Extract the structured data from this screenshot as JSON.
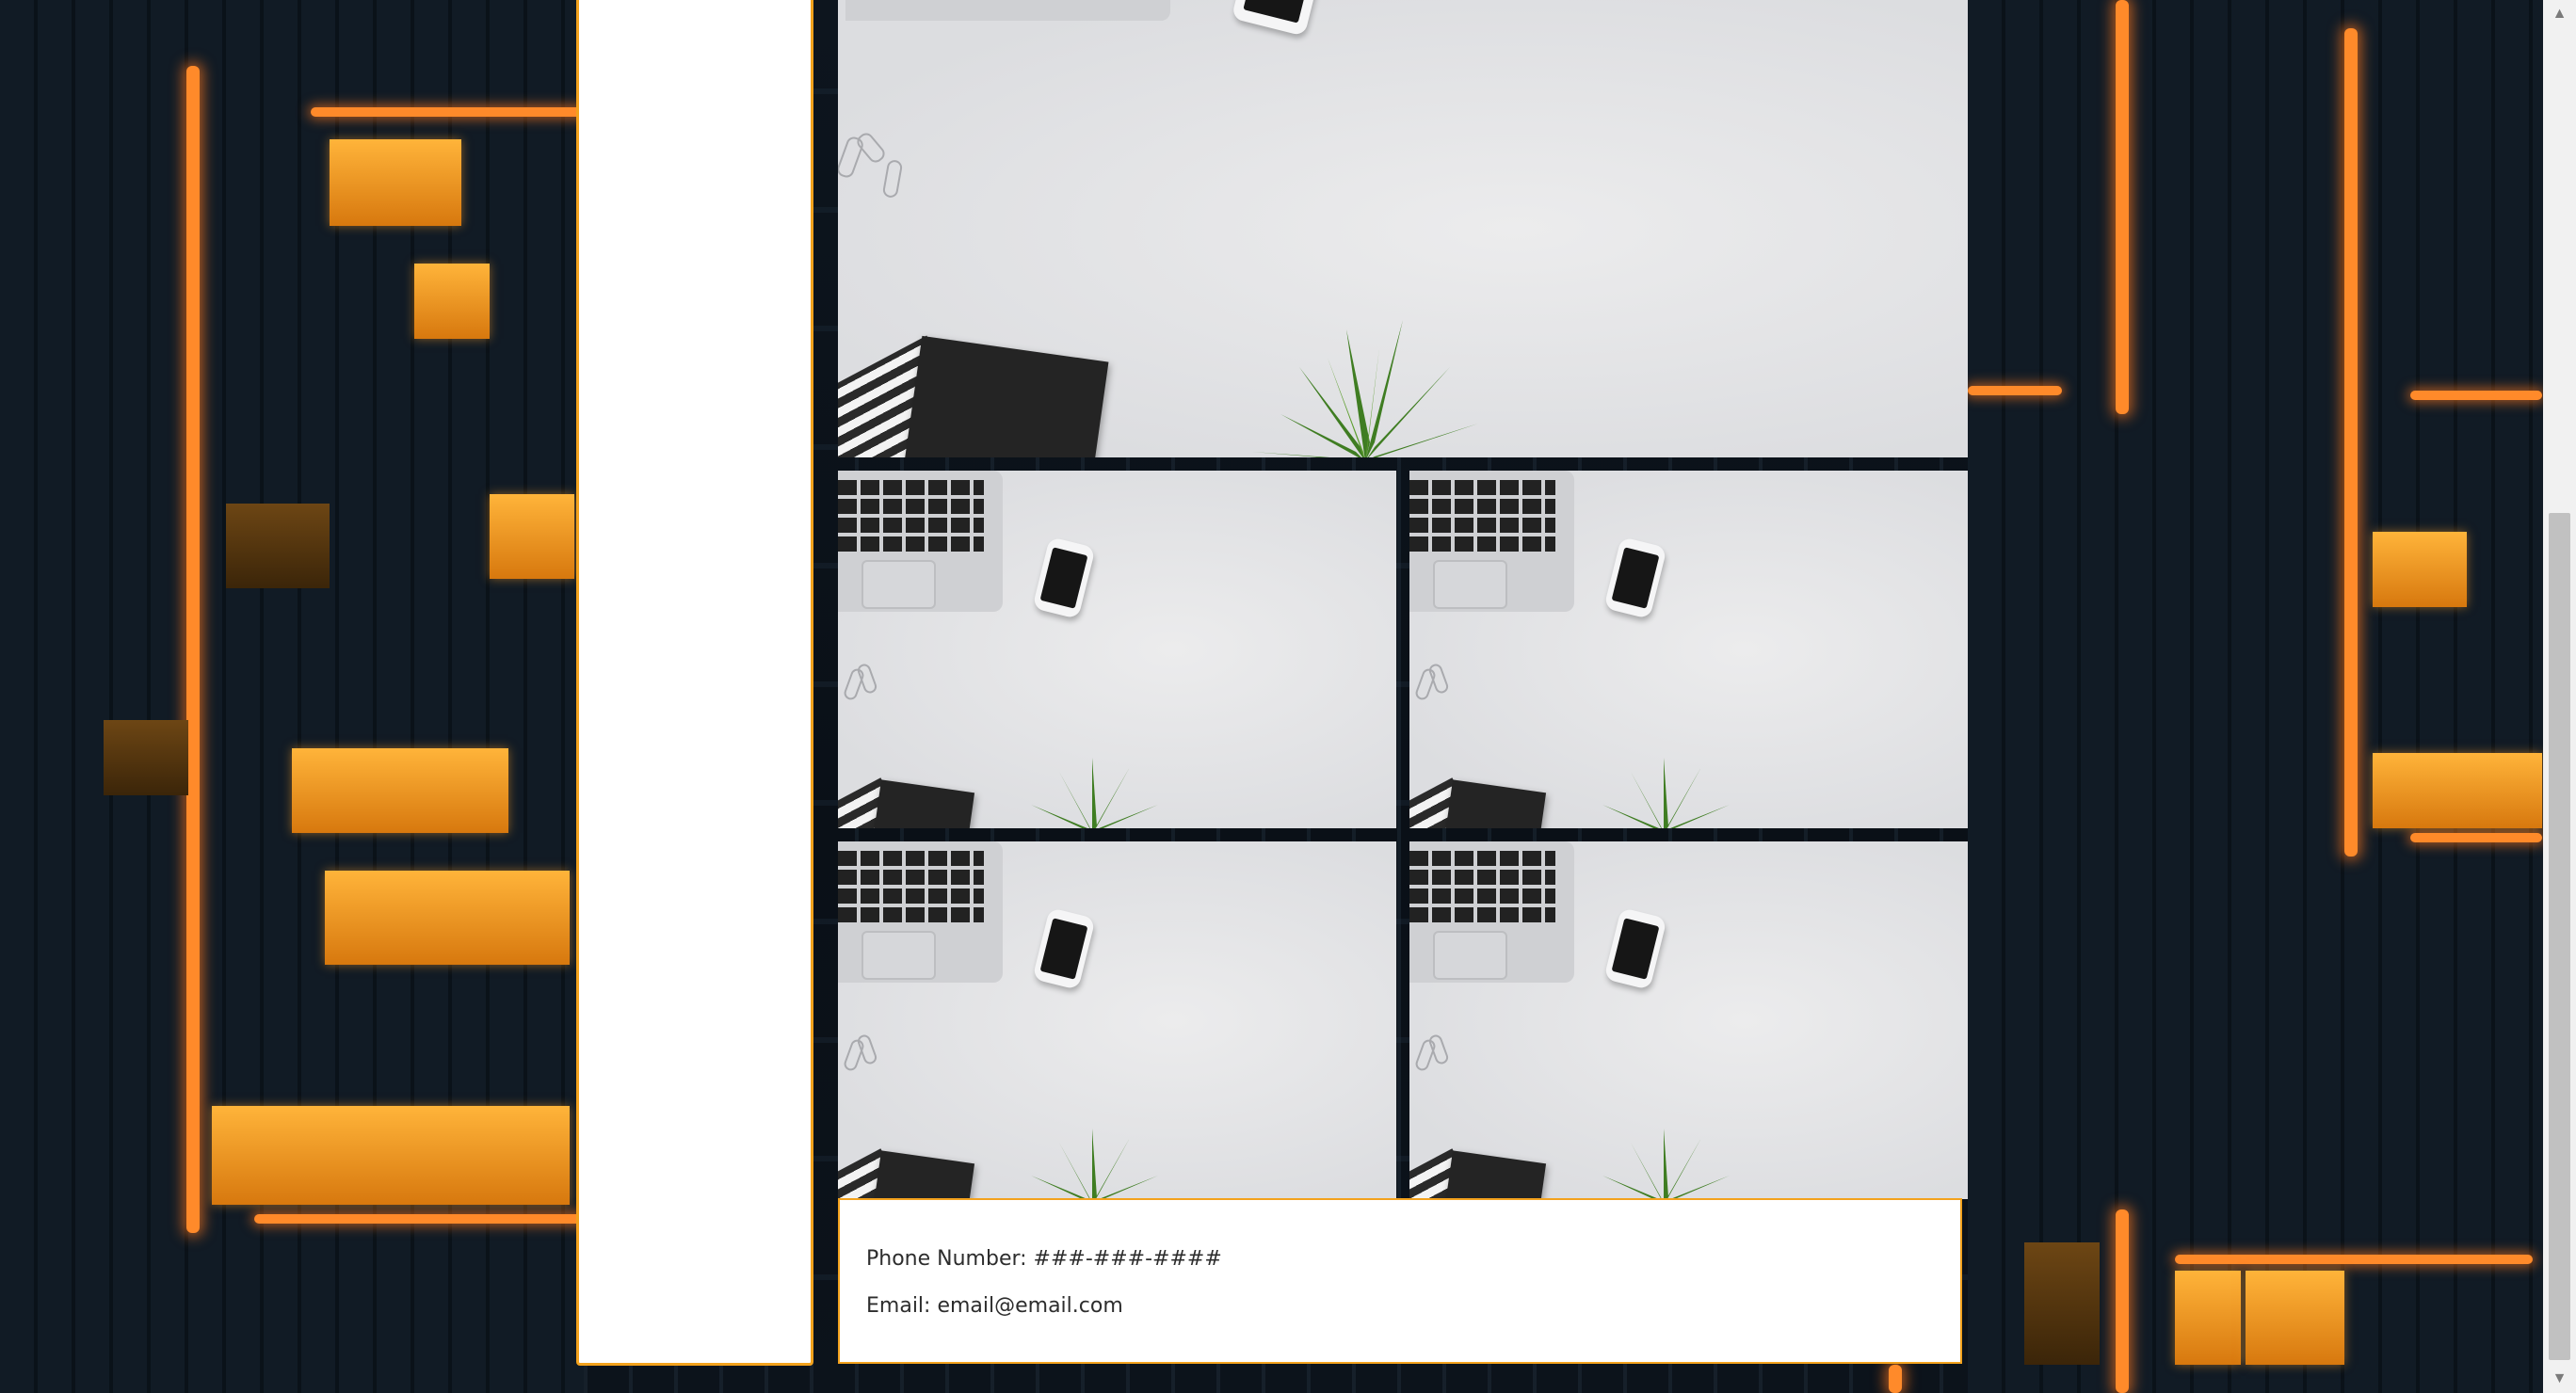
{
  "contact": {
    "phone": "Phone Number: ###-###-####",
    "email": "Email: email@email.com"
  },
  "scrollbar": {
    "up_icon": "▲",
    "down_icon": "▼"
  },
  "colors": {
    "accent": "#f3a21d",
    "neon": "#ff8a2a",
    "panel": "#ffffff"
  }
}
